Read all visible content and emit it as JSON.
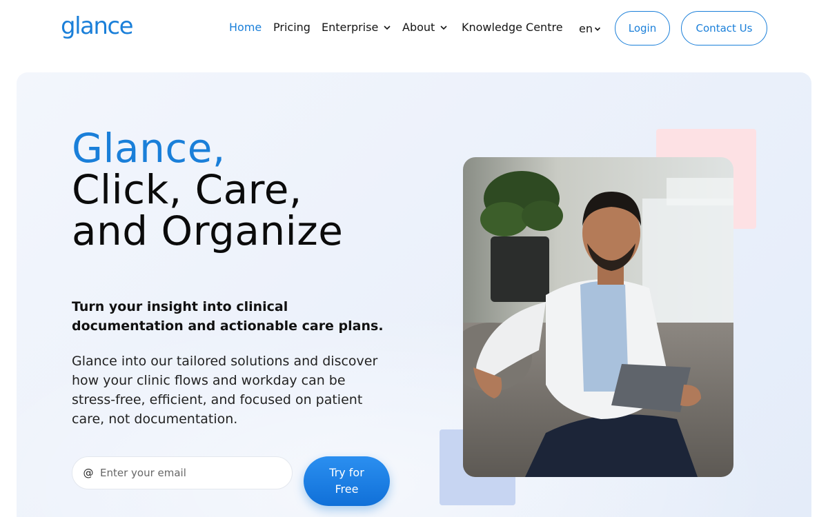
{
  "brand": {
    "logo_text": "glance",
    "accent": "#1a7fd9"
  },
  "nav": {
    "items": [
      {
        "label": "Home",
        "active": true
      },
      {
        "label": "Pricing"
      },
      {
        "label": "Enterprise",
        "dropdown": true
      },
      {
        "label": "About",
        "dropdown": true
      },
      {
        "label": "Knowledge Centre"
      }
    ],
    "language": "en",
    "login_label": "Login",
    "contact_label": "Contact Us"
  },
  "hero": {
    "heading_line1": "Glance,",
    "heading_line2": "Click, Care,",
    "heading_line3": "and Organize",
    "tagline": "Turn your insight into clinical documentation and actionable care plans.",
    "description": "Glance into our tailored solutions and discover how your clinic flows and workday can be stress-free, efficient, and focused on patient care, not documentation.",
    "email_placeholder": "Enter your email",
    "email_icon": "at-icon",
    "cta_label": "Try for Free"
  },
  "icons": {
    "dropdown": "chevron-down-icon",
    "email": "at-sign-icon"
  },
  "colors": {
    "hero_bg": "#eef3fb",
    "deco_pink": "#fde1e4",
    "deco_blue": "#c7d5f2",
    "cta_bg": "#1a7fd9"
  }
}
